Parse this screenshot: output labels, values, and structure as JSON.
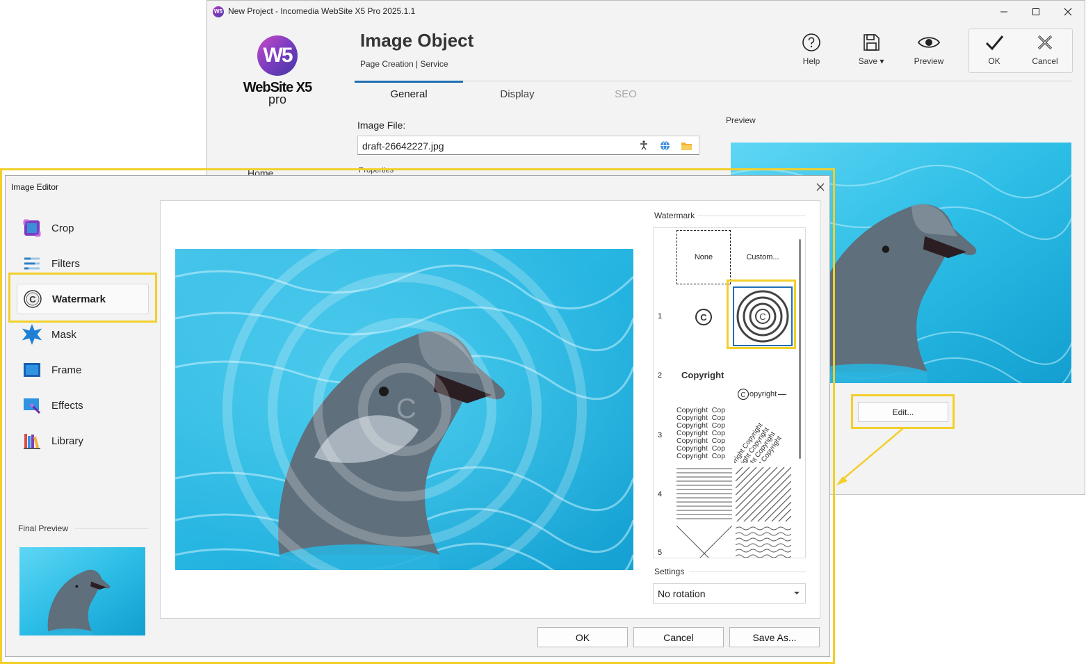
{
  "app": {
    "window_title": "New Project - Incomedia WebSite X5 Pro 2025.1.1",
    "icon_text": "W5",
    "logo_mark": "W5",
    "logo_text": "WebSite X5",
    "logo_sub": "pro"
  },
  "header": {
    "title": "Image Object",
    "subtitle": "Page Creation | Service"
  },
  "toolbar": {
    "help": "Help",
    "save": "Save ▾",
    "preview": "Preview",
    "ok": "OK",
    "cancel": "Cancel"
  },
  "tabs": [
    {
      "label": "General",
      "active": true
    },
    {
      "label": "Display",
      "active": false
    },
    {
      "label": "SEO",
      "active": false,
      "disabled": true
    }
  ],
  "image_file": {
    "label": "Image File:",
    "value": "draft-26642227.jpg"
  },
  "sidebar_home": "Home",
  "properties_label": "Properties",
  "preview_panel": {
    "label": "Preview",
    "edit_button": "Edit..."
  },
  "editor": {
    "title": "Image Editor",
    "sidebar": [
      {
        "label": "Crop",
        "icon": "crop-icon"
      },
      {
        "label": "Filters",
        "icon": "filters-icon"
      },
      {
        "label": "Watermark",
        "icon": "copyright-icon",
        "active": true
      },
      {
        "label": "Mask",
        "icon": "star-icon"
      },
      {
        "label": "Frame",
        "icon": "frame-icon"
      },
      {
        "label": "Effects",
        "icon": "magic-wand-icon"
      },
      {
        "label": "Library",
        "icon": "books-icon"
      }
    ],
    "final_preview_label": "Final Preview",
    "watermark": {
      "label": "Watermark",
      "none": "None",
      "custom": "Custom...",
      "rows": [
        "1",
        "2",
        "3",
        "4",
        "5"
      ],
      "copyright_bold": "Copyright",
      "copyright_small": "opyright",
      "copyright_repeat": "Copyright",
      "copyright_short": "Cop",
      "diagonal_text": "Copyright Copyright"
    },
    "settings": {
      "label": "Settings",
      "rotation": "No rotation"
    },
    "buttons": {
      "ok": "OK",
      "cancel": "Cancel",
      "save_as": "Save As..."
    }
  },
  "colors": {
    "accent": "#1e6fb3",
    "highlight": "#f2cf2a",
    "water_light": "#56d3f2",
    "water_dark": "#16a9d6"
  }
}
